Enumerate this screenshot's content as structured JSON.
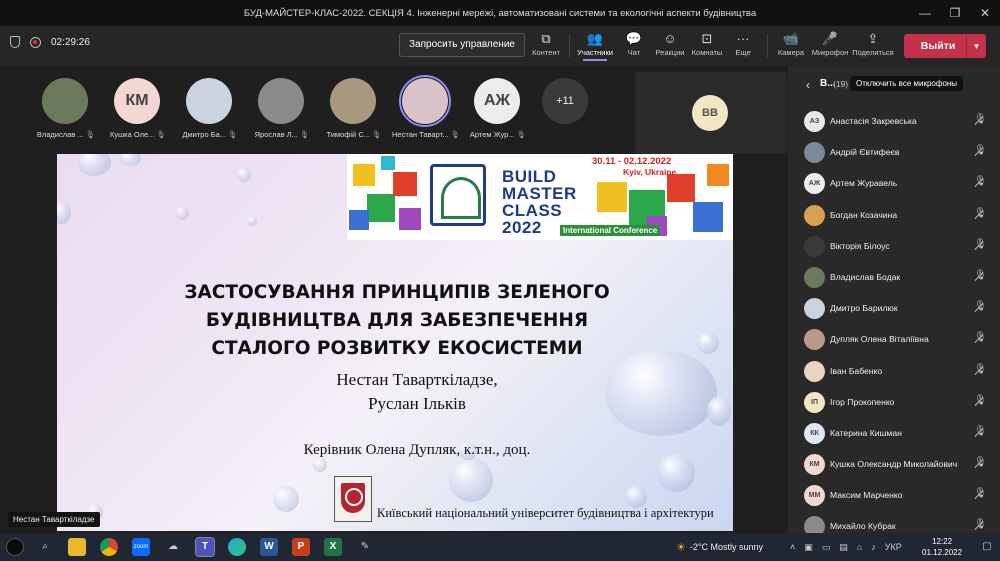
{
  "window": {
    "title": "БУД-МАЙСТЕР-КЛАС-2022. СЕКЦІЯ 4. Інженерні мережі, автоматизовані системи та екологічні аспекти будівництва",
    "min": "—",
    "max": "❐",
    "close": "✕"
  },
  "toolbar": {
    "timer": "02:29:26",
    "request_control": "Запросить управление",
    "items": [
      {
        "icon": "⧉",
        "label": "Контент"
      },
      {
        "icon": "👥",
        "label": "Участники"
      },
      {
        "icon": "💬",
        "label": "Чат"
      },
      {
        "icon": "☺",
        "label": "Реакции"
      },
      {
        "icon": "⊡",
        "label": "Комнаты"
      },
      {
        "icon": "···",
        "label": "Еще"
      },
      {
        "icon": "📹",
        "label": "Камера"
      },
      {
        "icon": "🎤",
        "label": "Микрофон"
      },
      {
        "icon": "⇪",
        "label": "Поделиться"
      }
    ],
    "leave": "Выйти"
  },
  "gallery": {
    "tiles": [
      {
        "name": "Владислав ...",
        "initials": "",
        "bg": "#6a7a5a"
      },
      {
        "name": "Кушка Оле...",
        "initials": "КМ",
        "bg": "#f4d6d3"
      },
      {
        "name": "Дмитро Ба...",
        "initials": "",
        "bg": "#c9d4e0"
      },
      {
        "name": "Ярослав Л...",
        "initials": "",
        "bg": "#8a8a8a"
      },
      {
        "name": "Тимофій С...",
        "initials": "",
        "bg": "#a89880"
      },
      {
        "name": "Нестан Таварт...",
        "initials": "",
        "bg": "#d9c2c8"
      },
      {
        "name": "Артем Жур...",
        "initials": "АЖ",
        "bg": "#ececec"
      }
    ],
    "more": "+11",
    "vb": "ВВ"
  },
  "slide": {
    "banner": {
      "dates": "30.11 - 02.12.2022",
      "city": "Kyiv, Ukraine",
      "line1": "BUILD",
      "line2": "MASTER",
      "line3": "CLASS",
      "line4": "2022",
      "conference": "International Conference"
    },
    "title_line1": "ЗАСТОСУВАННЯ ПРИНЦИПІВ ЗЕЛЕНОГО",
    "title_line2": "БУДІВНИЦТВА ДЛЯ ЗАБЕЗПЕЧЕННЯ",
    "title_line3": "СТАЛОГО РОЗВИТКУ ЕКОСИСТЕМИ",
    "author1": "Нестан Таварткіладзе,",
    "author2": "Руслан Ільків",
    "supervisor": "Керівник Олена Дупляк, к.т.н., доц.",
    "university": "Київський національний університет будівництва і архітектури"
  },
  "speaker_tag": "Нестан Таварткіладзе",
  "panel": {
    "title": "В...",
    "count": "(19)",
    "mute_all": "Отключить все микрофоны",
    "participants": [
      {
        "name": "Анастасія Закревська",
        "initials": "АЗ",
        "bg": "#e8e8e8"
      },
      {
        "name": "Андрій Євтифеєв",
        "initials": "",
        "bg": "#7a8a9a"
      },
      {
        "name": "Артем Журавель",
        "initials": "АЖ",
        "bg": "#ececec"
      },
      {
        "name": "Богдан Козачина",
        "initials": "",
        "bg": "#d8a050"
      },
      {
        "name": "Вікторія Білоус",
        "initials": "",
        "bg": "#3a3a3a"
      },
      {
        "name": "Владислав Бодак",
        "initials": "",
        "bg": "#6a7a5a"
      },
      {
        "name": "Дмитро Барилюк",
        "initials": "",
        "bg": "#c9d4e0"
      },
      {
        "name": "Дупляк Олена Віталіївна",
        "initials": "",
        "bg": "#b89a8a"
      },
      {
        "name": "Іван Бабенко",
        "initials": "",
        "bg": "#e8d4c0"
      },
      {
        "name": "Ігор Прокопенко",
        "initials": "ІП",
        "bg": "#f2e6c4"
      },
      {
        "name": "Катерина Кишман",
        "initials": "КК",
        "bg": "#dfe6f4"
      },
      {
        "name": "Кушка Олександр Миколайович",
        "initials": "КМ",
        "bg": "#f4d6d3"
      },
      {
        "name": "Максим Марченко",
        "initials": "ММ",
        "bg": "#f4d6d3"
      },
      {
        "name": "Михайло Кубрак",
        "initials": "",
        "bg": "#8a8a8a"
      }
    ]
  },
  "taskbar": {
    "weather": "-2°C  Mostly sunny",
    "lang": "УКР",
    "time": "12:22",
    "date": "01.12.2022"
  }
}
